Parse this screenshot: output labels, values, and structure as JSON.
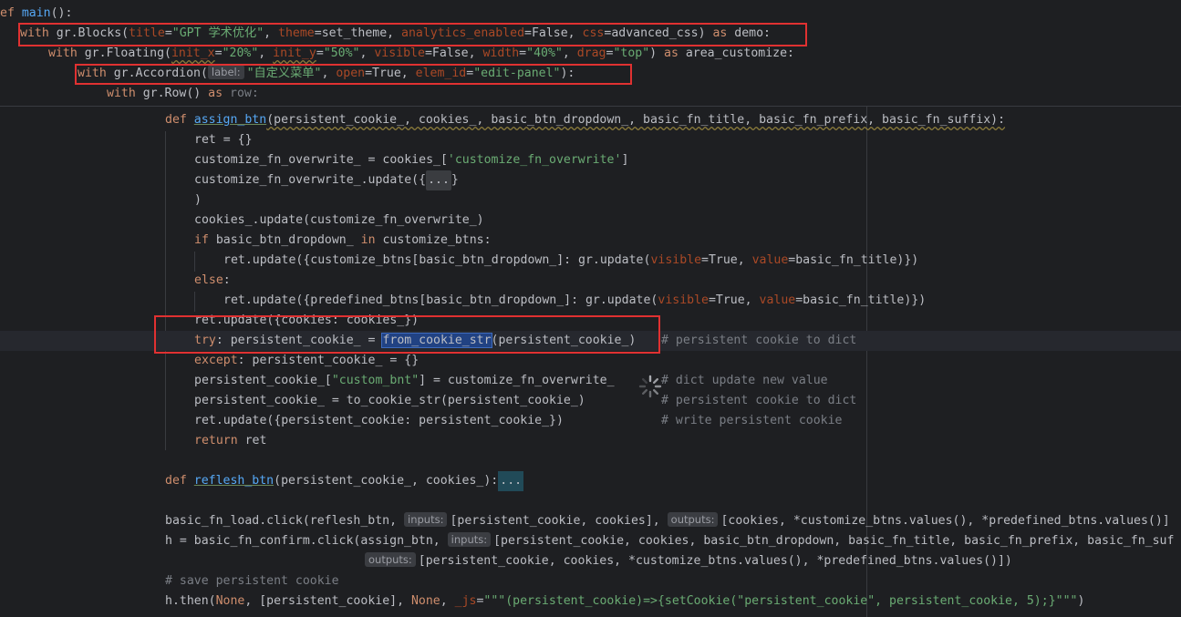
{
  "sticky": {
    "l1": {
      "kw": "ef",
      "name": "main",
      "rest": "():"
    },
    "l2": {
      "kw": "with",
      "p1": " gr.Blocks(",
      "a1": "title",
      "s1": "\"GPT 学术优化\"",
      "p2": ", ",
      "a2": "theme",
      "p3": "=set_theme, ",
      "a3": "analytics_enabled",
      "p4": "=False, ",
      "a4": "css",
      "p5": "=advanced_css) ",
      "kw2": "as",
      "p6": " demo:"
    },
    "l3": {
      "kw": "with",
      "p1": " gr.Floating(",
      "a1": "init_x",
      "e1": "=",
      "s1": "\"20%\"",
      "p2": ", ",
      "a2": "init_y",
      "e2": "=",
      "s2": "\"50%\"",
      "p3": ", ",
      "a3": "visible",
      "p4": "=False, ",
      "a4": "width",
      "e4": "=",
      "s4": "\"40%\"",
      "p5": ", ",
      "a5": "drag",
      "e5": "=",
      "s5": "\"top\"",
      "p6": ") ",
      "kw2": "as",
      "p7": " area_customize:"
    },
    "l4": {
      "kw": "with",
      "p1": " gr.Accordion(",
      "hint": "label:",
      "s1": "\"自定义菜单\"",
      "p2": ", ",
      "a2": "open",
      "p3": "=True, ",
      "a3": "elem_id",
      "e3": "=",
      "s3": "\"edit-panel\"",
      "p4": "):"
    },
    "l5": {
      "kw": "with",
      "p1": " gr.Row() ",
      "kw2": "as",
      "p2": " row:"
    }
  },
  "code": {
    "l6": {
      "kw": "def",
      "name": "assign_btn",
      "rest": "(persistent_cookie_, cookies_, basic_btn_dropdown_, basic_fn_title, basic_fn_prefix, basic_fn_suffix):"
    },
    "l7": "ret = {}",
    "l8": {
      "p1": "customize_fn_overwrite_ = cookies_[",
      "s1": "'customize_fn_overwrite'",
      "p2": "]"
    },
    "l9": {
      "p1": "customize_fn_overwrite_.update({",
      "fold": "...",
      "p2": "}"
    },
    "l10": ")",
    "l11": "cookies_.update(customize_fn_overwrite_)",
    "l12": {
      "kw": "if",
      "p1": " basic_btn_dropdown_ ",
      "kw2": "in",
      "p2": " customize_btns:"
    },
    "l13": {
      "p1": "ret.update({customize_btns[basic_btn_dropdown_]: gr.update(",
      "a1": "visible",
      "p2": "=True, ",
      "a2": "value",
      "p3": "=basic_fn_title)})"
    },
    "l14": {
      "kw": "else",
      "p1": ":"
    },
    "l15": {
      "p1": "ret.update({predefined_btns[basic_btn_dropdown_]: gr.update(",
      "a1": "visible",
      "p2": "=True, ",
      "a2": "value",
      "p3": "=basic_fn_title)})"
    },
    "l16": "ret.update({cookies: cookies_})",
    "l17": {
      "kw": "try",
      "p1": ": persistent_cookie_ = ",
      "sel": "from_cookie_str",
      "p2": "(persistent_cookie_)",
      "cmt": "# persistent cookie to dict"
    },
    "l18": {
      "kw": "except",
      "p1": ": persistent_cookie_ = {}"
    },
    "l19": {
      "p1": "persistent_cookie_[",
      "s1": "\"custom_bnt\"",
      "p2": "] = customize_fn_overwrite_",
      "cmt": "# dict update new value"
    },
    "l20": {
      "p1": "persistent_cookie_ = to_cookie_str(persistent_cookie_)",
      "cmt": "# persistent cookie to dict"
    },
    "l21": {
      "p1": "ret.update({persistent_cookie: persistent_cookie_})",
      "cmt": "# write persistent cookie"
    },
    "l22": {
      "kw": "return",
      "p1": " ret"
    },
    "l23": {
      "kw": "def",
      "name": "reflesh_btn",
      "p1": "(persistent_cookie_, cookies_):",
      "fold": "..."
    },
    "l24": {
      "p1": "basic_fn_load.click(reflesh_btn, ",
      "hint1": "inputs:",
      "p2": "[persistent_cookie, cookies], ",
      "hint2": "outputs:",
      "p3": "[cookies, *customize_btns.values(), *predefined_btns.values()]"
    },
    "l25": {
      "p1": "h = basic_fn_confirm.click(assign_btn, ",
      "hint1": "inputs:",
      "p2": "[persistent_cookie, cookies, basic_btn_dropdown, basic_fn_title, basic_fn_prefix, basic_fn_suf"
    },
    "l26": {
      "hint1": "outputs:",
      "p1": "[persistent_cookie, cookies, *customize_btns.values(), *predefined_btns.values()])"
    },
    "l27": "# save persistent cookie",
    "l28": {
      "p1": "h.then(",
      "kw": "None",
      "p2": ", [persistent_cookie], ",
      "kw2": "None",
      "p3": ", ",
      "a1": "_js",
      "p4": "=",
      "s1": "\"\"\"(persistent_cookie)=>{setCookie(\"persistent_cookie\", persistent_cookie, 5);}\"\"\"",
      "p5": ")"
    }
  },
  "colors": {
    "background": "#1e1f22",
    "keyword": "#cf8e6d",
    "function": "#56a8f5",
    "string": "#6aab73",
    "param": "#aa4926",
    "comment": "#7a7e85",
    "highlight_box": "#e03131",
    "selection": "#214283"
  }
}
